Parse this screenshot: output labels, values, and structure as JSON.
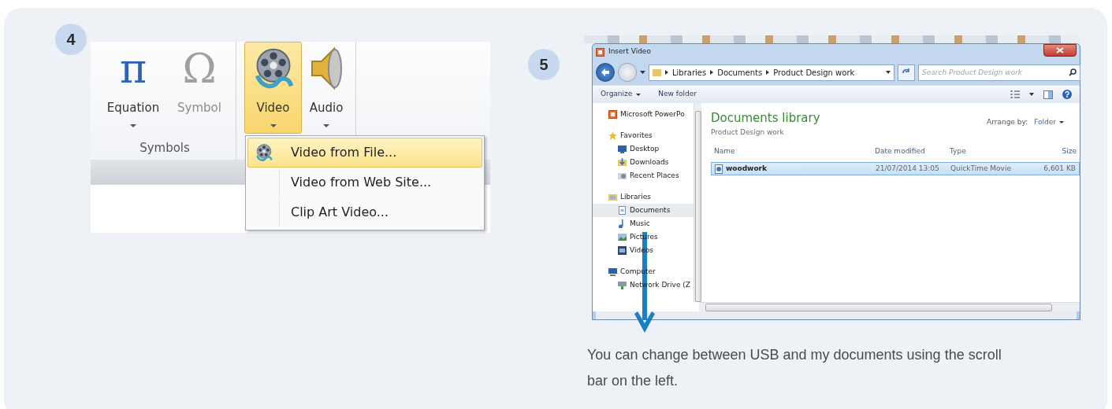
{
  "steps": [
    {
      "number": "4",
      "kind": "ribbon",
      "ribbon": {
        "groups": [
          {
            "label": "Symbols",
            "buttons": [
              {
                "kind": "glyph",
                "glyph": "π",
                "label": "Equation",
                "disabled": false,
                "selected": false,
                "dropdown": true
              },
              {
                "kind": "glyph",
                "glyph": "Ω",
                "label": "Symbol",
                "disabled": true,
                "selected": false,
                "dropdown": false
              }
            ]
          },
          {
            "buttons": [
              {
                "kind": "video",
                "label": "Video",
                "disabled": false,
                "selected": true,
                "dropdown": true
              },
              {
                "kind": "audio",
                "label": "Audio",
                "disabled": false,
                "selected": false,
                "dropdown": true
              }
            ]
          }
        ],
        "menu": [
          {
            "label": "Video from File...",
            "selected": true,
            "has_icon": true
          },
          {
            "label": "Video from Web Site...",
            "selected": false,
            "has_icon": false
          },
          {
            "label": "Clip Art Video...",
            "selected": false,
            "has_icon": false
          }
        ]
      }
    },
    {
      "number": "5",
      "kind": "dialog",
      "dialog": {
        "title": "Insert Video",
        "breadcrumb": [
          "Libraries",
          "Documents",
          "Product Design work"
        ],
        "search": {
          "placeholder": "Search Product Design work"
        },
        "toolbar": [
          {
            "label": "Organize",
            "dropdown": true
          },
          {
            "label": "New folder",
            "dropdown": false
          }
        ],
        "nav": [
          {
            "kind": "app",
            "label": "Microsoft PowerPo",
            "selected": false
          },
          {
            "kind": "star",
            "label": "Favorites",
            "selected": false,
            "children": [
              {
                "kind": "desktop",
                "label": "Desktop",
                "selected": false
              },
              {
                "kind": "downloads",
                "label": "Downloads",
                "selected": false
              },
              {
                "kind": "recent",
                "label": "Recent Places",
                "selected": false
              }
            ]
          },
          {
            "kind": "library",
            "label": "Libraries",
            "selected": false,
            "children": [
              {
                "kind": "document",
                "label": "Documents",
                "selected": true
              },
              {
                "kind": "music",
                "label": "Music",
                "selected": false
              },
              {
                "kind": "pictures",
                "label": "Pictures",
                "selected": false
              },
              {
                "kind": "videos",
                "label": "Videos",
                "selected": false
              }
            ]
          },
          {
            "kind": "computer",
            "label": "Computer",
            "selected": false,
            "children": [
              {
                "kind": "network",
                "label": "Network Drive (Z",
                "selected": false
              }
            ]
          }
        ],
        "library": {
          "title": "Documents library",
          "subtitle": "Product Design work",
          "arrange_label": "Arrange by:",
          "arrange_value": "Folder"
        },
        "columns": [
          "Name",
          "Date modified",
          "Type",
          "Size"
        ],
        "rows": [
          {
            "cells": [
              "woodwork",
              "21/07/2014 13:05",
              "QuickTime Movie",
              "6,601 KB"
            ],
            "selected": true
          }
        ]
      },
      "caption": "You can change between USB and my documents using the scroll bar on the left."
    }
  ]
}
